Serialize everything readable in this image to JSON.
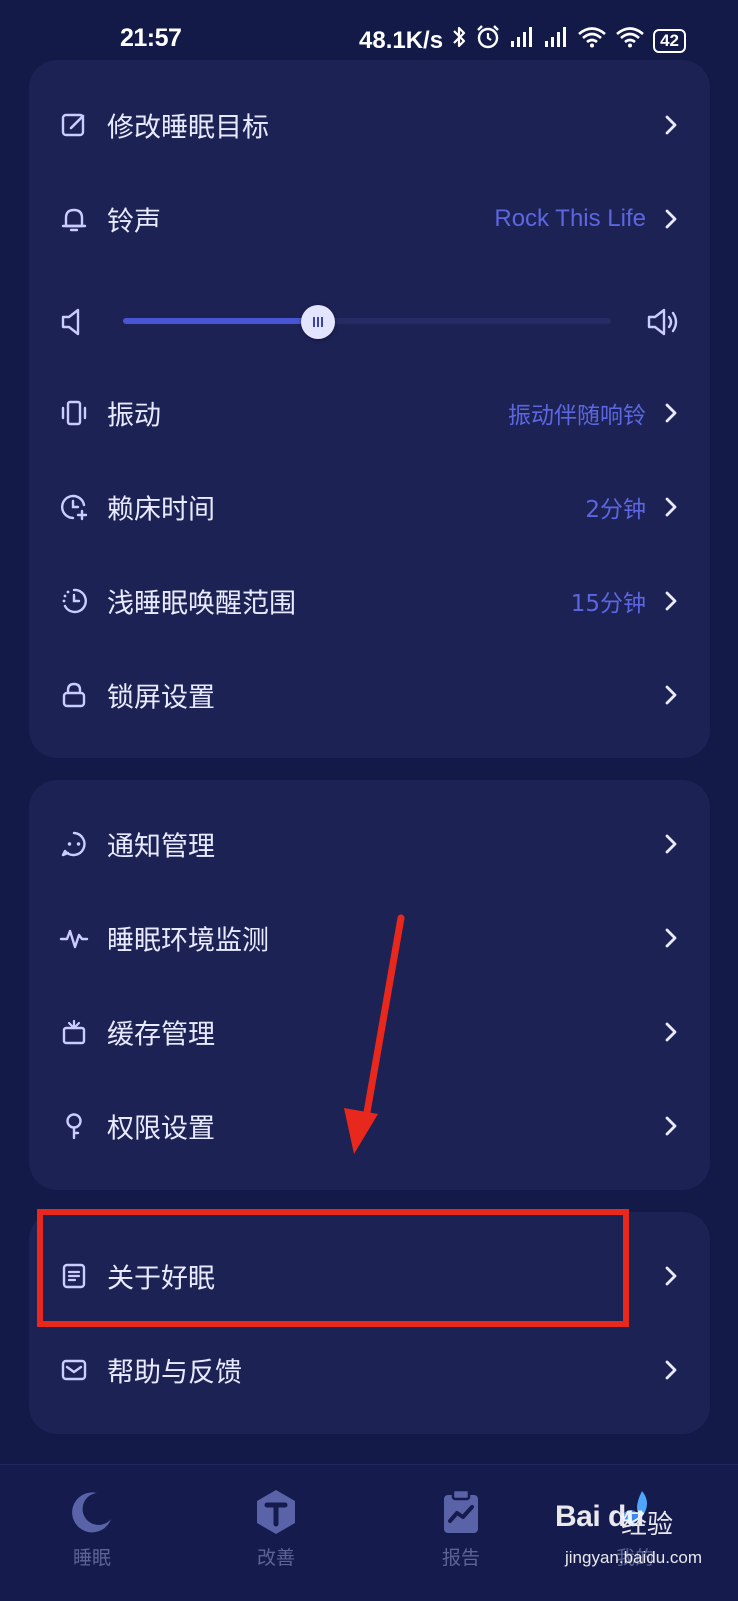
{
  "status_bar": {
    "time": "21:57",
    "network_speed": "48.1K/s",
    "battery": "42"
  },
  "card1": {
    "items": [
      {
        "label": "修改睡眠目标",
        "value": "",
        "icon": "edit-icon"
      },
      {
        "label": "铃声",
        "value": "Rock This Life",
        "icon": "bell-icon"
      },
      {
        "label": "振动",
        "value": "振动伴随响铃",
        "icon": "vibrate-icon"
      },
      {
        "label": "赖床时间",
        "value": "2分钟",
        "icon": "clock-plus-icon"
      },
      {
        "label": "浅睡眠唤醒范围",
        "value": "15分钟",
        "icon": "clock-range-icon"
      },
      {
        "label": "锁屏设置",
        "value": "",
        "icon": "lock-icon"
      }
    ],
    "volume_level": 0.4
  },
  "card2": {
    "items": [
      {
        "label": "通知管理",
        "icon": "chat-icon"
      },
      {
        "label": "睡眠环境监测",
        "icon": "pulse-icon"
      },
      {
        "label": "缓存管理",
        "icon": "trash-icon"
      },
      {
        "label": "权限设置",
        "icon": "key-icon"
      }
    ]
  },
  "card3": {
    "items": [
      {
        "label": "关于好眠",
        "icon": "document-icon"
      },
      {
        "label": "帮助与反馈",
        "icon": "mail-icon"
      }
    ]
  },
  "tabbar": {
    "tabs": [
      {
        "label": "睡眠",
        "icon": "moon-icon"
      },
      {
        "label": "改善",
        "icon": "improve-icon"
      },
      {
        "label": "报告",
        "icon": "report-icon"
      },
      {
        "label": "我的",
        "icon": "profile-icon"
      }
    ]
  },
  "watermark": {
    "brand": "Bai du",
    "cn": "经验",
    "url": "jingyan.baidu.com"
  },
  "colors": {
    "background": "#131a48",
    "card": "#1d2254",
    "accent": "#5b66e0",
    "annotation": "#e8271d"
  }
}
